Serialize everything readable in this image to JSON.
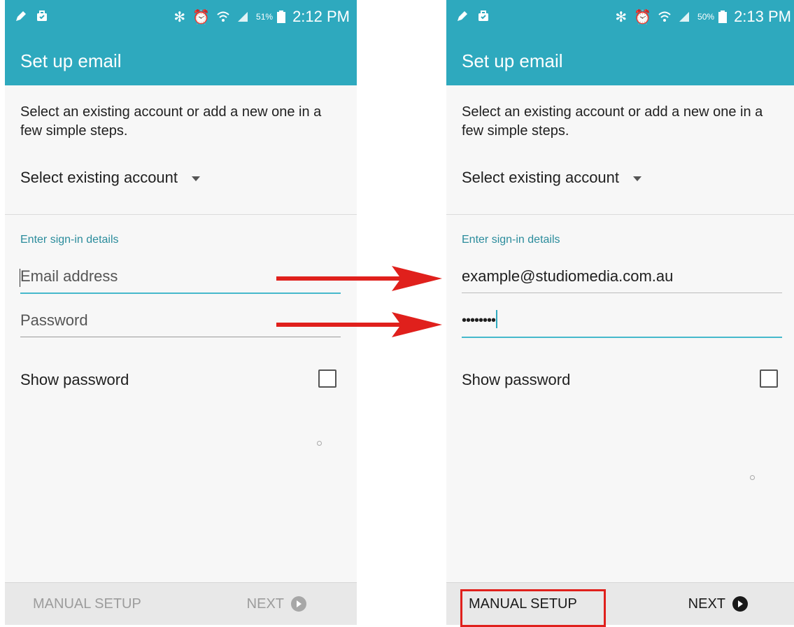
{
  "screens": [
    {
      "status": {
        "battery_percent": "51%",
        "time": "2:12 PM"
      },
      "title": "Set up email",
      "intro": "Select an existing account or add a new one in a few simple steps.",
      "account_select_label": "Select existing account",
      "section_label": "Enter sign-in details",
      "email": {
        "placeholder": "Email address",
        "value": ""
      },
      "password": {
        "placeholder": "Password",
        "value": ""
      },
      "show_password_label": "Show password",
      "show_password_checked": false,
      "buttons": {
        "manual_setup": "MANUAL SETUP",
        "next": "NEXT",
        "enabled": false
      }
    },
    {
      "status": {
        "battery_percent": "50%",
        "time": "2:13 PM"
      },
      "title": "Set up email",
      "intro": "Select an existing account or add a new one in a few simple steps.",
      "account_select_label": "Select existing account",
      "section_label": "Enter sign-in details",
      "email": {
        "placeholder": "Email address",
        "value": "example@studiomedia.com.au"
      },
      "password": {
        "placeholder": "Password",
        "value": "••••••••"
      },
      "show_password_label": "Show password",
      "show_password_checked": false,
      "buttons": {
        "manual_setup": "MANUAL SETUP",
        "next": "NEXT",
        "enabled": true
      }
    }
  ],
  "annotations": {
    "arrow_color": "#e0201c",
    "highlight_target": "manual-setup-button"
  },
  "colors": {
    "appbar": "#2ea9be",
    "accent_line": "#46b9cc",
    "section_label": "#2b8c9c"
  },
  "icons": [
    "pen-icon",
    "bag-icon",
    "bluetooth-icon",
    "alarm-icon",
    "wifi-icon",
    "signal-icon",
    "battery-icon",
    "chevron-down-icon",
    "next-arrow-icon"
  ]
}
